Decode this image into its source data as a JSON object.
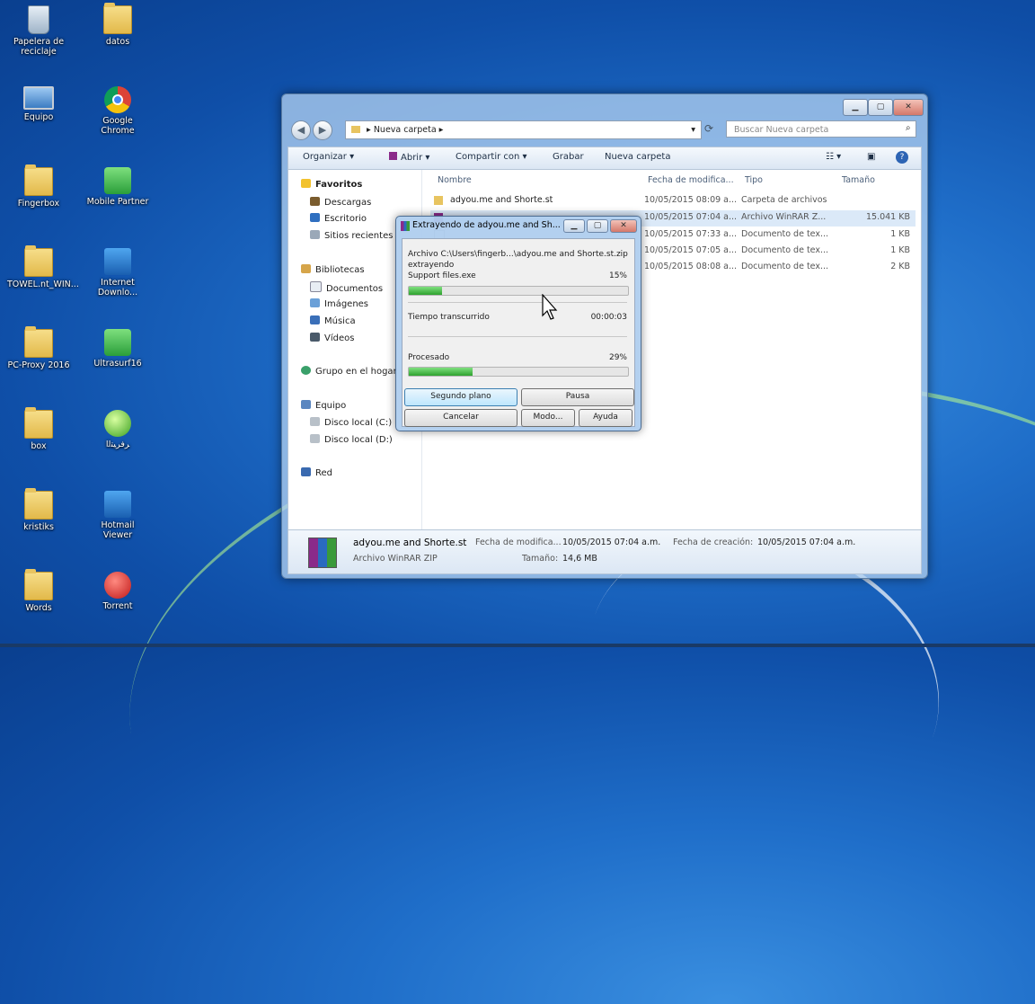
{
  "desktop": {
    "icons": [
      {
        "label": "Papelera de reciclaje",
        "icon": "recycle-bin-icon"
      },
      {
        "label": "datos",
        "icon": "folder-icon"
      },
      {
        "label": "Equipo",
        "icon": "computer-icon"
      },
      {
        "label": "Google Chrome",
        "icon": "chrome-icon"
      },
      {
        "label": "Fingerbox",
        "icon": "folder-icon"
      },
      {
        "label": "Mobile Partner",
        "icon": "mobile-partner-icon"
      },
      {
        "label": "TOWEL.nt_WIN...",
        "icon": "folder-icon"
      },
      {
        "label": "Internet Downlo...",
        "icon": "internet-download-manager-icon"
      },
      {
        "label": "PC-Proxy 2016",
        "icon": "folder-icon"
      },
      {
        "label": "Ultrasurf16",
        "icon": "ultrasurf-icon"
      },
      {
        "label": "box",
        "icon": "folder-icon"
      },
      {
        "label": "ﺮﻓﺮﯿﺘﻟا",
        "icon": "app-icon"
      },
      {
        "label": "kristiks",
        "icon": "folder-icon"
      },
      {
        "label": "Hotmail Viewer",
        "icon": "shortcut-icon"
      },
      {
        "label": "Words",
        "icon": "folder-icon"
      },
      {
        "label": "Torrent",
        "icon": "torrent-icon"
      }
    ]
  },
  "explorer": {
    "address": "Nueva carpeta",
    "search_placeholder": "Buscar Nueva carpeta",
    "toolbar": {
      "organize": "Organizar",
      "open": "Abrir",
      "share": "Compartir con",
      "burn": "Grabar",
      "new_folder": "Nueva carpeta"
    },
    "nav": {
      "favorites": "Favoritos",
      "downloads": "Descargas",
      "desktop": "Escritorio",
      "recent": "Sitios recientes",
      "libraries": "Bibliotecas",
      "documents": "Documentos",
      "images": "Imágenes",
      "music": "Música",
      "videos": "Vídeos",
      "homegroup": "Grupo en el hogar",
      "computer": "Equipo",
      "disk_c": "Disco local (C:)",
      "disk_d": "Disco local (D:)",
      "network": "Red"
    },
    "columns": {
      "name": "Nombre",
      "modified": "Fecha de modifica...",
      "type": "Tipo",
      "size": "Tamaño"
    },
    "files": [
      {
        "name": "adyou.me and Shorte.st",
        "modified": "10/05/2015 08:09 a...",
        "type": "Carpeta de archivos",
        "size": ""
      },
      {
        "name": "",
        "modified": "10/05/2015 07:04 a...",
        "type": "Archivo WinRAR Z...",
        "size": "15.041 KB"
      },
      {
        "name": "",
        "modified": "10/05/2015 07:33 a...",
        "type": "Documento de tex...",
        "size": "1 KB"
      },
      {
        "name": "",
        "modified": "10/05/2015 07:05 a...",
        "type": "Documento de tex...",
        "size": "1 KB"
      },
      {
        "name": "",
        "modified": "10/05/2015 08:08 a...",
        "type": "Documento de tex...",
        "size": "2 KB"
      }
    ],
    "details": {
      "name": "adyou.me and Shorte.st",
      "type": "Archivo WinRAR ZIP",
      "modified_label": "Fecha de modifica...",
      "modified_value": "10/05/2015 07:04 a.m.",
      "created_label": "Fecha de creación:",
      "created_value": "10/05/2015 07:04 a.m.",
      "size_label": "Tamaño:",
      "size_value": "14,6 MB"
    }
  },
  "winrar": {
    "title": "Extrayendo de adyou.me and Sh...",
    "archive_line": "Archivo C:\\Users\\fingerb...\\adyou.me and Shorte.st.zip",
    "status": "extrayendo",
    "current_file": "Support files.exe",
    "file_percent": "15%",
    "file_progress": 0.15,
    "elapsed_label": "Tiempo transcurrido",
    "elapsed_value": "00:00:03",
    "processed_label": "Procesado",
    "processed_percent": "29%",
    "processed_progress": 0.29,
    "buttons": {
      "background": "Segundo plano",
      "pause": "Pausa",
      "cancel": "Cancelar",
      "mode": "Modo...",
      "help": "Ayuda"
    }
  }
}
